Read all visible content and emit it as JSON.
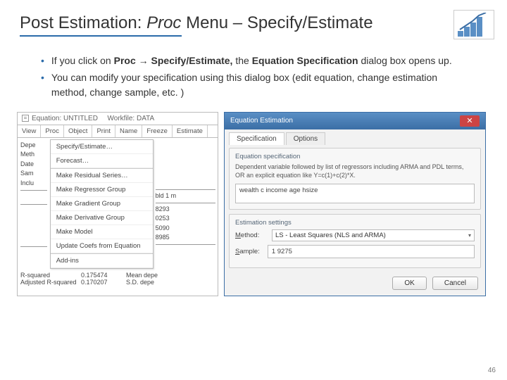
{
  "title": {
    "pre": "Post Estimation: ",
    "italic": "Proc",
    "post": " Menu – Specify/Estimate"
  },
  "bullets": [
    "If you click on <b>Proc → Specify/Estimate,</b> the <b>Equation Specification</b> dialog box opens up.",
    "You can modify your specification using this dialog box (edit equation, change estimation method, change sample, etc. )"
  ],
  "wf": {
    "title_pre": "Equation: UNTITLED",
    "title_post": "Workfile: DATA",
    "toolbar": [
      "View",
      "Proc",
      "Object",
      "Print",
      "Name",
      "Freeze",
      "Estimate"
    ],
    "left_labels": [
      "Depe",
      "Meth",
      "Date",
      "Sam",
      "Inclu"
    ],
    "menu": [
      "Specify/Estimate…",
      "Forecast…",
      "Make Residual Series…",
      "Make Regressor Group",
      "Make Gradient Group",
      "Make Derivative Group",
      "Make Model",
      "Update Coefs from Equation",
      "Add-ins"
    ],
    "bottom_left": [
      "R-squared",
      "Adjusted R-squared"
    ],
    "bottom_vals_a": [
      "0.175474",
      "0.170207"
    ],
    "bottom_vals_b": [
      "Mean depe",
      "S.D. depe"
    ],
    "right_nums": [
      "8293",
      "0253",
      "5090",
      "8985"
    ],
    "right_top": "bld 1 m"
  },
  "dlg": {
    "title": "Equation Estimation",
    "tabs": [
      "Specification",
      "Options"
    ],
    "group1_label": "Equation specification",
    "help": "Dependent variable followed by list of regressors including ARMA and PDL terms, OR an explicit equation like Y=c(1)+c(2)*X.",
    "eq_value": "wealth c income age hsize",
    "group2_label": "Estimation settings",
    "method_label": "Method:",
    "method_value": "LS - Least Squares (NLS and ARMA)",
    "sample_label": "Sample:",
    "sample_value": "1 9275",
    "ok": "OK",
    "cancel": "Cancel"
  },
  "pagenum": "46"
}
